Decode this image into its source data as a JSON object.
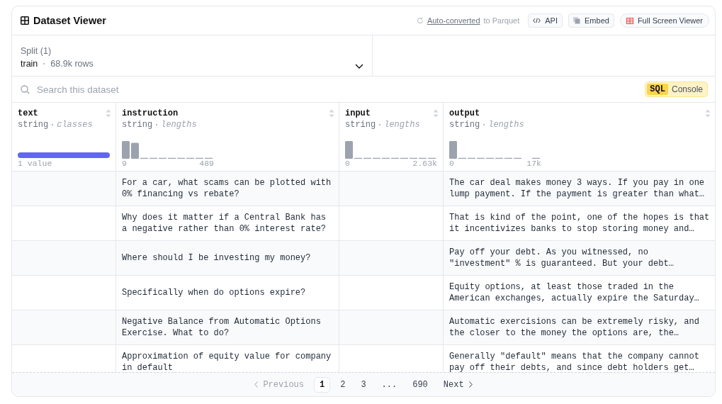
{
  "header": {
    "title": "Dataset Viewer",
    "converted_link": "Auto-converted",
    "converted_rest": "to Parquet",
    "buttons": [
      {
        "kind": "api",
        "label": "API"
      },
      {
        "kind": "embed",
        "label": "Embed"
      },
      {
        "kind": "fullscreen",
        "label": "Full Screen Viewer"
      }
    ]
  },
  "split": {
    "label": "Split (1)",
    "name": "train",
    "rows": "68.9k rows"
  },
  "search": {
    "placeholder": "Search this dataset"
  },
  "sql_console": {
    "badge": "SQL",
    "label": "Console"
  },
  "columns": [
    {
      "name": "text",
      "type": "string",
      "stat": "classes",
      "kind": "classes",
      "summary": "1 value"
    },
    {
      "name": "instruction",
      "type": "string",
      "stat": "lengths",
      "kind": "histogram",
      "min": "9",
      "max": "489"
    },
    {
      "name": "input",
      "type": "string",
      "stat": "lengths",
      "kind": "histogram",
      "min": "0",
      "max": "2.63k"
    },
    {
      "name": "output",
      "type": "string",
      "stat": "lengths",
      "kind": "histogram",
      "min": "0",
      "max": "17k"
    }
  ],
  "rows": [
    {
      "instruction": "For a car, what scams can be plotted with 0% financing vs rebate?",
      "output": "The car deal makes money 3 ways. If you pay in one lump payment. If the payment is greater than what…"
    },
    {
      "instruction": "Why does it matter if a Central Bank has a negative rather than 0% interest rate?",
      "output": "That is kind of the point, one of the hopes is that it incentivizes banks to stop storing money and…"
    },
    {
      "instruction": "Where should I be investing my money?",
      "output": "Pay off your debt. As you witnessed, no \"investment\" % is guaranteed. But your debt…"
    },
    {
      "instruction": "Specifically when do options expire?",
      "output": "Equity options, at least those traded in the American exchanges, actually expire the Saturday…"
    },
    {
      "instruction": "Negative Balance from Automatic Options Exercise. What to do?",
      "output": "Automatic exercisions can be extremely risky, and the closer to the money the options are, the…"
    },
    {
      "instruction": "Approximation of equity value for company in default",
      "output": "Generally \"default\" means that the company cannot pay off their debts, and since debt holders get…"
    }
  ],
  "pagination": {
    "previous": "Previous",
    "next": "Next",
    "pages": [
      {
        "label": "1",
        "selected": true
      },
      {
        "label": "2",
        "selected": false
      },
      {
        "label": "3",
        "selected": false
      },
      {
        "label": "...",
        "selected": false
      },
      {
        "label": "690",
        "selected": false
      }
    ]
  }
}
